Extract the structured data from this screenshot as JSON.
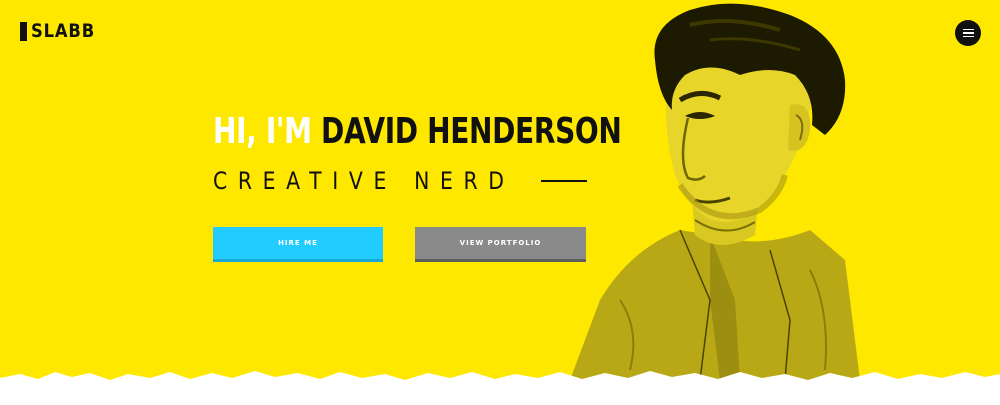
{
  "brand": {
    "logo_text": "SLABB"
  },
  "colors": {
    "background": "#ffe800",
    "accent_blue": "#22ccff",
    "button_gray": "#8a8a8a",
    "text_dark": "#111111",
    "text_light": "#ffffff"
  },
  "nav": {
    "menu_icon": "hamburger-menu-icon"
  },
  "hero": {
    "greeting": "HI, I'M",
    "name": "DAVID HENDERSON",
    "tagline": "CREATIVE NERD",
    "primary_button": "HIRE ME",
    "secondary_button": "VIEW PORTFOLIO"
  }
}
